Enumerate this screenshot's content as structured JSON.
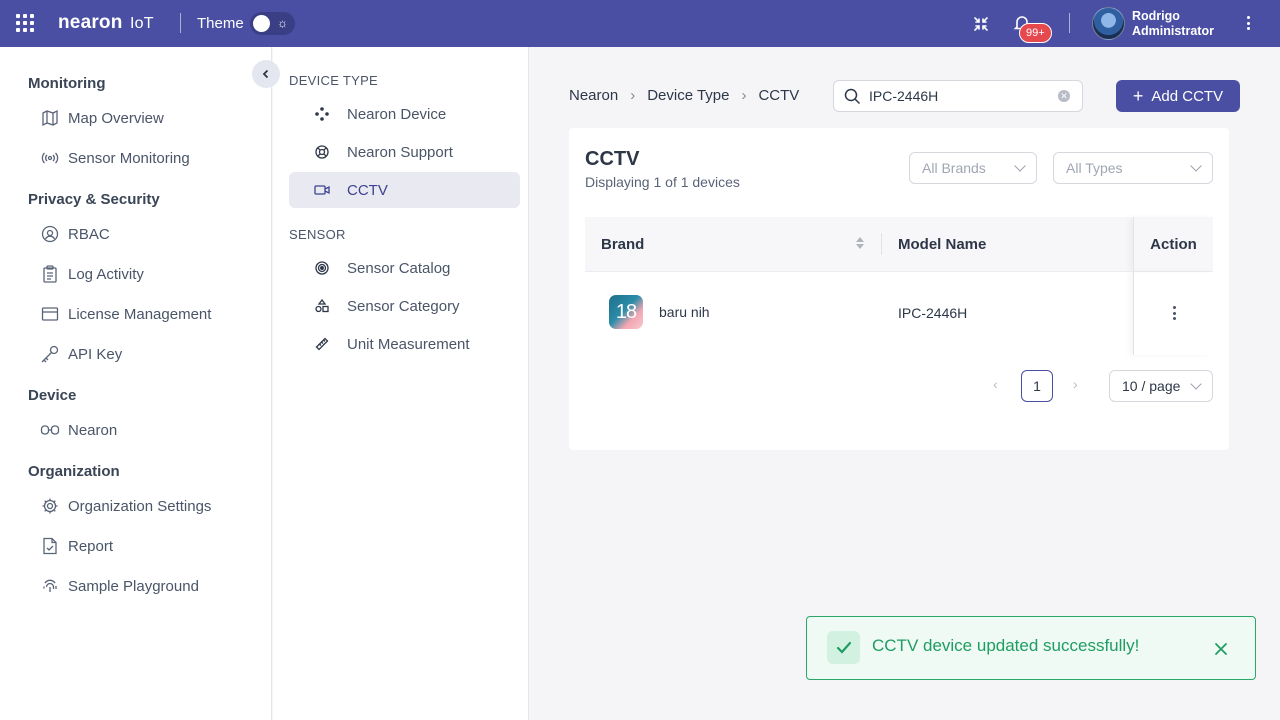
{
  "header": {
    "brand_main": "nearon",
    "brand_suffix": "IoT",
    "theme_label": "Theme",
    "notification_badge": "99+",
    "user_name": "Rodrigo",
    "user_role": "Administrator"
  },
  "sidebar": {
    "sections": [
      {
        "title": "Monitoring",
        "items": [
          {
            "label": "Map Overview",
            "icon": "map-icon"
          },
          {
            "label": "Sensor Monitoring",
            "icon": "broadcast-icon"
          }
        ]
      },
      {
        "title": "Privacy & Security",
        "items": [
          {
            "label": "RBAC",
            "icon": "user-circle-icon"
          },
          {
            "label": "Log Activity",
            "icon": "clipboard-icon"
          },
          {
            "label": "License Management",
            "icon": "card-icon"
          },
          {
            "label": "API Key",
            "icon": "key-icon"
          }
        ]
      },
      {
        "title": "Device",
        "items": [
          {
            "label": "Nearon",
            "icon": "nearon-icon"
          }
        ]
      },
      {
        "title": "Organization",
        "items": [
          {
            "label": "Organization Settings",
            "icon": "gear-icon"
          },
          {
            "label": "Report",
            "icon": "report-icon"
          },
          {
            "label": "Sample Playground",
            "icon": "fingerprint-icon"
          }
        ]
      }
    ]
  },
  "panel2": {
    "device_type_title": "DEVICE TYPE",
    "device_items": [
      {
        "label": "Nearon Device",
        "icon": "diamond-dots-icon"
      },
      {
        "label": "Nearon Support",
        "icon": "lifebuoy-icon"
      },
      {
        "label": "CCTV",
        "icon": "video-camera-icon"
      }
    ],
    "sensor_title": "SENSOR",
    "sensor_items": [
      {
        "label": "Sensor Catalog",
        "icon": "target-icon"
      },
      {
        "label": "Sensor Category",
        "icon": "shapes-icon"
      },
      {
        "label": "Unit Measurement",
        "icon": "ruler-icon"
      }
    ]
  },
  "breadcrumb": [
    "Nearon",
    "Device Type",
    "CCTV"
  ],
  "search": {
    "value": "IPC-2446H"
  },
  "add_button": "Add CCTV",
  "card": {
    "title": "CCTV",
    "subtitle": "Displaying 1 of 1 devices",
    "filter_brand_placeholder": "All Brands",
    "filter_type_placeholder": "All Types",
    "columns": [
      "Brand",
      "Model Name",
      "Action"
    ],
    "rows": [
      {
        "brand": "baru nih",
        "brand_logo_text": "18",
        "model": "IPC-2446H"
      }
    ],
    "page": "1",
    "page_size": "10 / page"
  },
  "toast": {
    "message": "CCTV device updated successfully!"
  },
  "colors": {
    "primary": "#4a4fa3",
    "success": "#1f9d63",
    "badge": "#e5484d"
  }
}
